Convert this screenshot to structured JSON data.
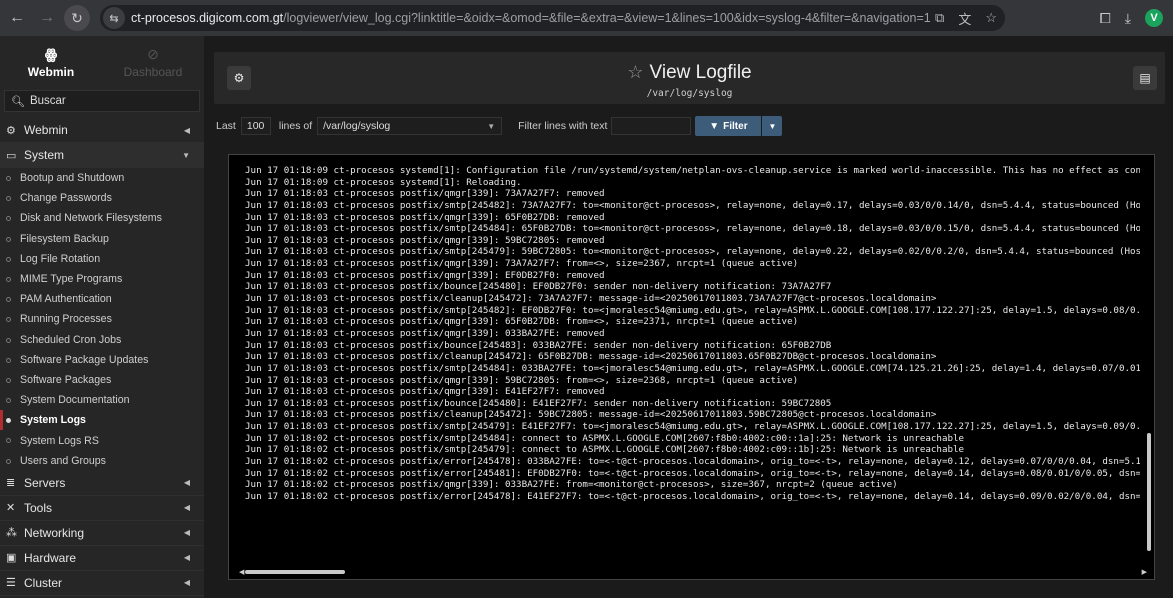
{
  "browser": {
    "url_host": "ct-procesos.digicom.com.gt",
    "url_path": "/logviewer/view_log.cgi?linktitle=&oidx=&omod=&file=&extra=&view=1&lines=100&idx=syslog-4&filter=&navigation=1",
    "avatar_letter": "V",
    "icons": [
      "back-icon",
      "forward-icon",
      "reload-icon",
      "site-info-icon",
      "install-icon",
      "translate-icon",
      "bookmark-star-icon",
      "extensions-icon",
      "download-icon"
    ]
  },
  "sidebar": {
    "tab_webmin": "Webmin",
    "tab_dashboard": "Dashboard",
    "search_placeholder": "Buscar",
    "categories": [
      {
        "label": "Webmin"
      },
      {
        "label": "System"
      },
      {
        "label": "Servers"
      },
      {
        "label": "Tools"
      },
      {
        "label": "Networking"
      },
      {
        "label": "Hardware"
      },
      {
        "label": "Cluster"
      }
    ],
    "system_items": [
      {
        "label": "Bootup and Shutdown"
      },
      {
        "label": "Change Passwords"
      },
      {
        "label": "Disk and Network Filesystems"
      },
      {
        "label": "Filesystem Backup"
      },
      {
        "label": "Log File Rotation"
      },
      {
        "label": "MIME Type Programs"
      },
      {
        "label": "PAM Authentication"
      },
      {
        "label": "Running Processes"
      },
      {
        "label": "Scheduled Cron Jobs"
      },
      {
        "label": "Software Package Updates"
      },
      {
        "label": "Software Packages"
      },
      {
        "label": "System Documentation"
      },
      {
        "label": "System Logs"
      },
      {
        "label": "System Logs RS"
      },
      {
        "label": "Users and Groups"
      }
    ],
    "active_item": "System Logs"
  },
  "header": {
    "title": "View Logfile",
    "subtitle": "/var/log/syslog"
  },
  "filter_bar": {
    "last_label": "Last",
    "lines_value": "100",
    "lines_of_label": "lines of",
    "file_value": "/var/log/syslog",
    "filter_text_label": "Filter lines with text",
    "filter_value": "",
    "filter_button": "Filter"
  },
  "log": {
    "lines": [
      "Jun 17 01:18:09 ct-procesos systemd[1]: Configuration file /run/systemd/system/netplan-ovs-cleanup.service is marked world-inaccessible. This has no effect as conf",
      "Jun 17 01:18:09 ct-procesos systemd[1]: Reloading.",
      "Jun 17 01:18:03 ct-procesos postfix/qmgr[339]: 73A7A27F7: removed",
      "Jun 17 01:18:03 ct-procesos postfix/smtp[245482]: 73A7A27F7: to=<monitor@ct-procesos>, relay=none, delay=0.17, delays=0.03/0/0.14/0, dsn=5.4.4, status=bounced (Hos",
      "Jun 17 01:18:03 ct-procesos postfix/qmgr[339]: 65F0B27DB: removed",
      "Jun 17 01:18:03 ct-procesos postfix/smtp[245484]: 65F0B27DB: to=<monitor@ct-procesos>, relay=none, delay=0.18, delays=0.03/0/0.15/0, dsn=5.4.4, status=bounced (Hos",
      "Jun 17 01:18:03 ct-procesos postfix/qmgr[339]: 59BC72805: removed",
      "Jun 17 01:18:03 ct-procesos postfix/smtp[245479]: 59BC72805: to=<monitor@ct-procesos>, relay=none, delay=0.22, delays=0.02/0/0.2/0, dsn=5.4.4, status=bounced (Host",
      "Jun 17 01:18:03 ct-procesos postfix/qmgr[339]: 73A7A27F7: from=<>, size=2367, nrcpt=1 (queue active)",
      "Jun 17 01:18:03 ct-procesos postfix/qmgr[339]: EF0DB27F0: removed",
      "Jun 17 01:18:03 ct-procesos postfix/bounce[245480]: EF0DB27F0: sender non-delivery notification: 73A7A27F7",
      "Jun 17 01:18:03 ct-procesos postfix/cleanup[245472]: 73A7A27F7: message-id=<20250617011803.73A7A27F7@ct-procesos.localdomain>",
      "Jun 17 01:18:03 ct-procesos postfix/smtp[245482]: EF0DB27F0: to=<jmoralesc54@miumg.edu.gt>, relay=ASPMX.L.GOOGLE.COM[108.177.122.27]:25, delay=1.5, delays=0.08/0.0",
      "Jun 17 01:18:03 ct-procesos postfix/qmgr[339]: 65F0B27DB: from=<>, size=2371, nrcpt=1 (queue active)",
      "Jun 17 01:18:03 ct-procesos postfix/qmgr[339]: 033BA27FE: removed",
      "Jun 17 01:18:03 ct-procesos postfix/bounce[245483]: 033BA27FE: sender non-delivery notification: 65F0B27DB",
      "Jun 17 01:18:03 ct-procesos postfix/cleanup[245472]: 65F0B27DB: message-id=<20250617011803.65F0B27DB@ct-procesos.localdomain>",
      "Jun 17 01:18:03 ct-procesos postfix/smtp[245484]: 033BA27FE: to=<jmoralesc54@miumg.edu.gt>, relay=ASPMX.L.GOOGLE.COM[74.125.21.26]:25, delay=1.4, delays=0.07/0.01/",
      "Jun 17 01:18:03 ct-procesos postfix/qmgr[339]: 59BC72805: from=<>, size=2368, nrcpt=1 (queue active)",
      "Jun 17 01:18:03 ct-procesos postfix/qmgr[339]: E41EF27F7: removed",
      "Jun 17 01:18:03 ct-procesos postfix/bounce[245480]: E41EF27F7: sender non-delivery notification: 59BC72805",
      "Jun 17 01:18:03 ct-procesos postfix/cleanup[245472]: 59BC72805: message-id=<20250617011803.59BC72805@ct-procesos.localdomain>",
      "Jun 17 01:18:03 ct-procesos postfix/smtp[245479]: E41EF27F7: to=<jmoralesc54@miumg.edu.gt>, relay=ASPMX.L.GOOGLE.COM[108.177.122.27]:25, delay=1.5, delays=0.09/0.0",
      "Jun 17 01:18:02 ct-procesos postfix/smtp[245484]: connect to ASPMX.L.GOOGLE.COM[2607:f8b0:4002:c00::1a]:25: Network is unreachable",
      "Jun 17 01:18:02 ct-procesos postfix/smtp[245479]: connect to ASPMX.L.GOOGLE.COM[2607:f8b0:4002:c09::1b]:25: Network is unreachable",
      "Jun 17 01:18:02 ct-procesos postfix/error[245478]: 033BA27FE: to=<-t@ct-procesos.localdomain>, orig_to=<-t>, relay=none, delay=0.12, delays=0.07/0/0/0.04, dsn=5.1",
      "Jun 17 01:18:02 ct-procesos postfix/error[245481]: EF0DB27F0: to=<-t@ct-procesos.localdomain>, orig_to=<-t>, relay=none, delay=0.14, delays=0.08/0.01/0/0.05, dsn=5",
      "Jun 17 01:18:02 ct-procesos postfix/qmgr[339]: 033BA27FE: from=<monitor@ct-procesos>, size=367, nrcpt=2 (queue active)",
      "Jun 17 01:18:02 ct-procesos postfix/error[245478]: E41EF27F7: to=<-t@ct-procesos.localdomain>, orig_to=<-t>, relay=none, delay=0.14, delays=0.09/0.02/0/0.04, dsn=5"
    ]
  },
  "colors": {
    "accent_active": "#b12d2d",
    "filter_button": "#3d5c7a",
    "avatar": "#1aa35c"
  }
}
